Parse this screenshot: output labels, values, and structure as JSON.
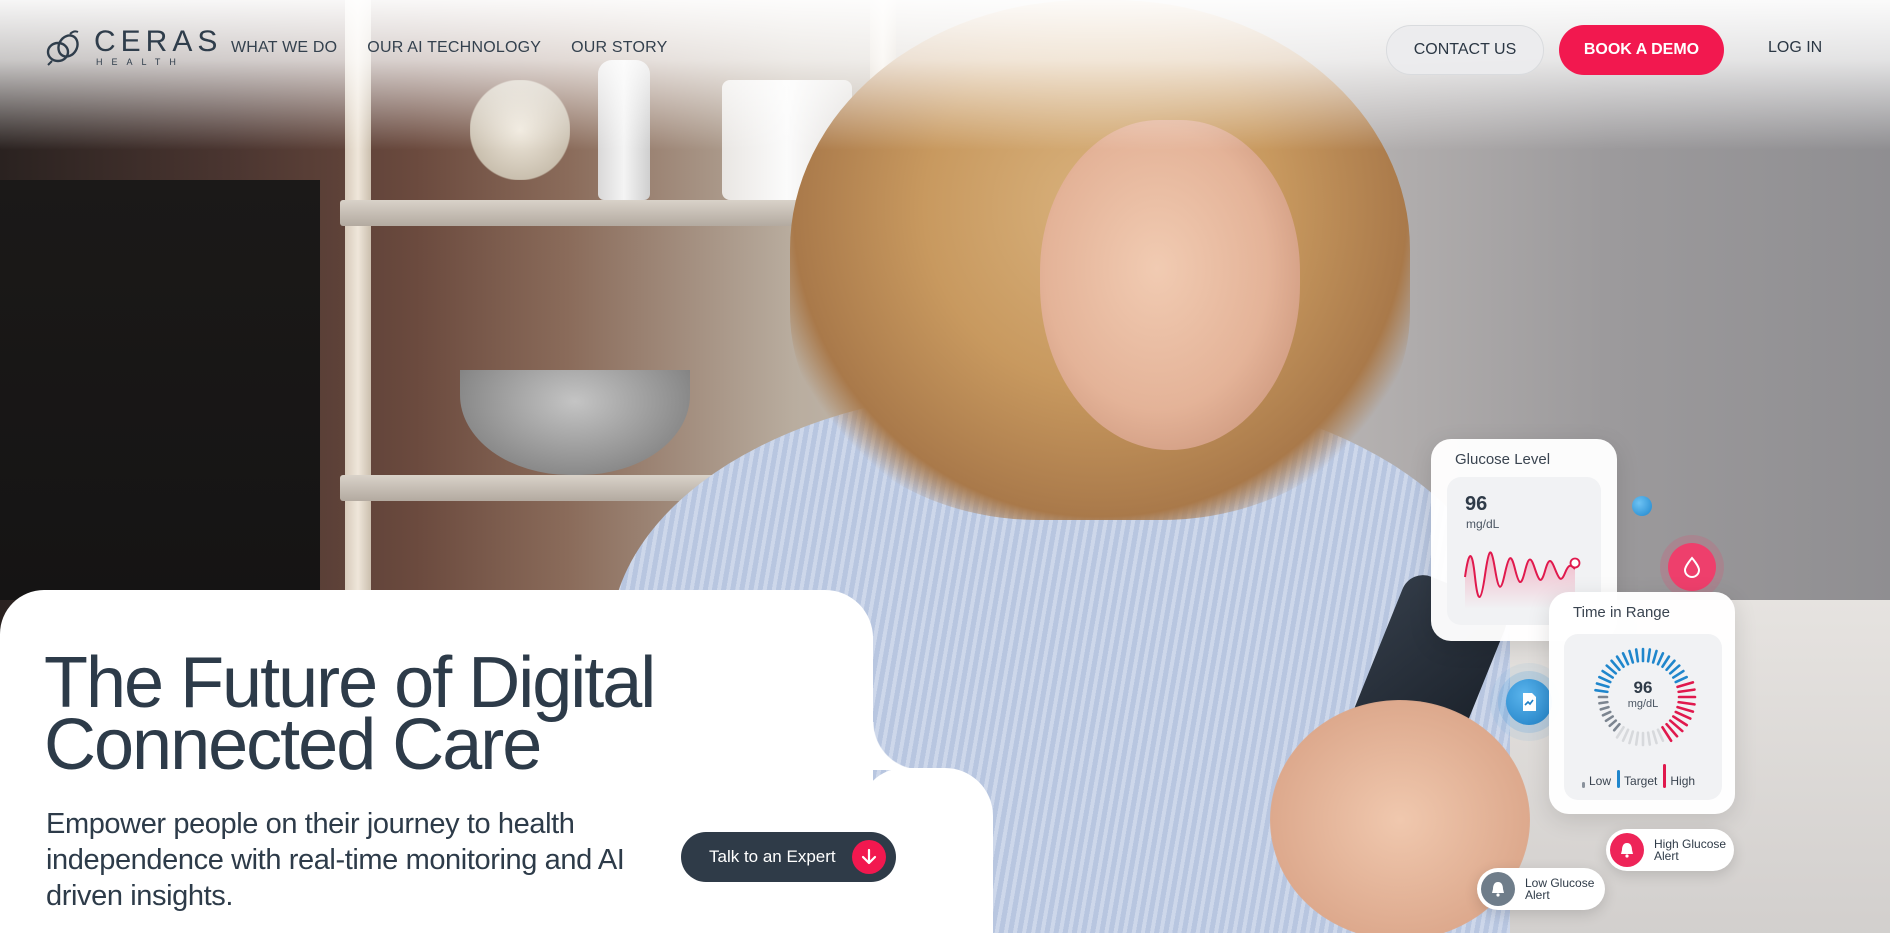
{
  "brand": {
    "name": "CERAS",
    "tagline": "HEALTH",
    "accent": "#f2184f",
    "dark": "#2f3b48",
    "blue": "#1f86cc"
  },
  "nav": {
    "items": [
      {
        "label": "WHAT WE DO"
      },
      {
        "label": "OUR AI TECHNOLOGY"
      },
      {
        "label": "OUR STORY"
      }
    ],
    "contact_label": "CONTACT US",
    "demo_label": "BOOK A DEMO",
    "login_label": "LOG IN"
  },
  "hero": {
    "headline_line1": "The Future of Digital",
    "headline_line2": "Connected Care",
    "subhead": "Empower people on their journey to health independence with real-time monitoring and AI driven insights.",
    "cta_label": "Talk to an Expert"
  },
  "widgets": {
    "glucose": {
      "title": "Glucose Level",
      "value": "96",
      "unit": "mg/dL"
    },
    "time_in_range": {
      "title": "Time in Range",
      "value": "96",
      "unit": "mg/dL",
      "legend": {
        "low": "Low",
        "target": "Target",
        "high": "High"
      }
    },
    "alerts": {
      "high": "High Glucose Alert",
      "low": "Low Glucose Alert"
    }
  }
}
